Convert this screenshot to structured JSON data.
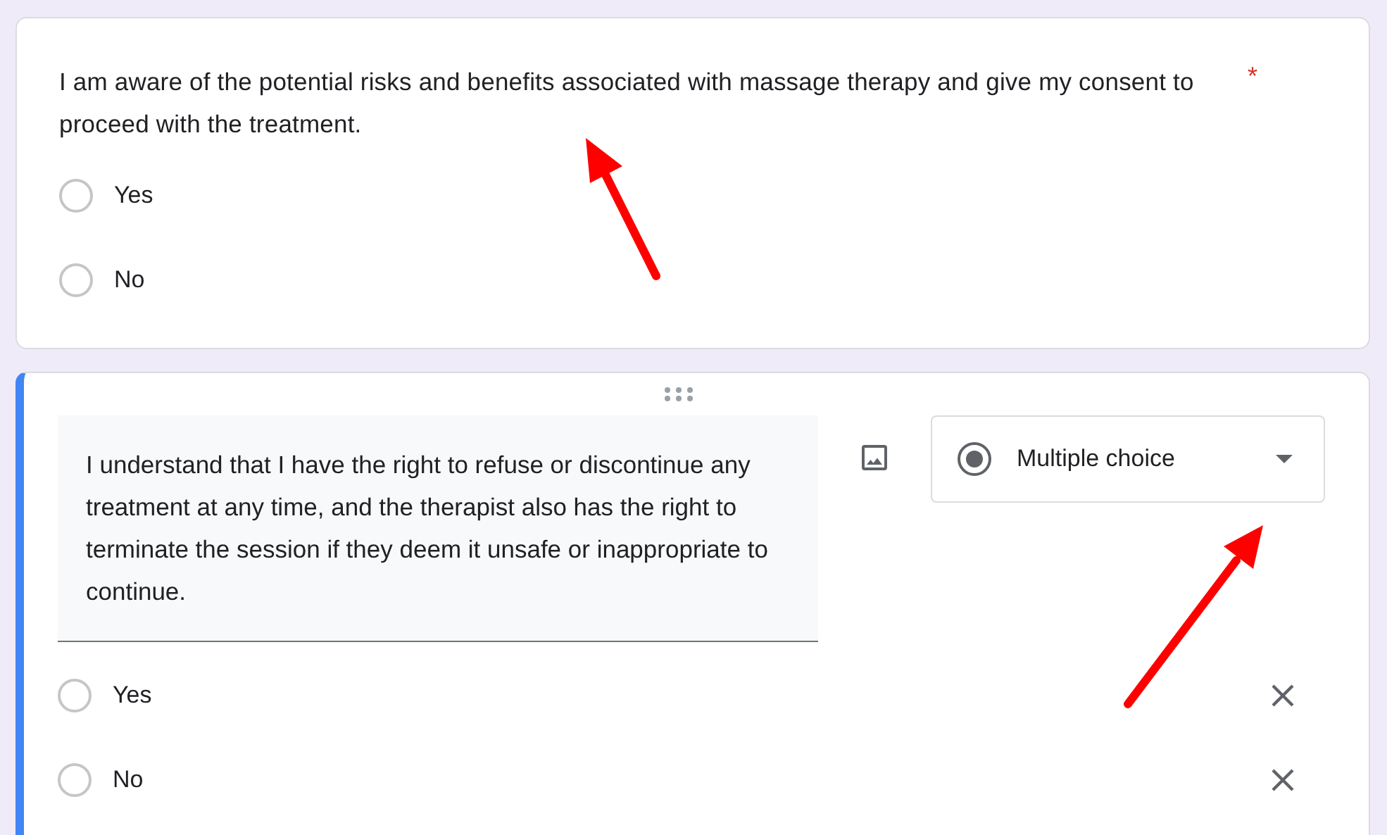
{
  "questions": [
    {
      "kind": "view",
      "text": "I am aware of the potential risks and benefits associated with massage therapy and give my consent to proceed with the treatment.",
      "required_mark": "*",
      "options": [
        {
          "label": "Yes",
          "selected": false
        },
        {
          "label": "No",
          "selected": false
        }
      ]
    },
    {
      "kind": "edit",
      "text": "I understand that I have the right to refuse or discontinue any treatment at any time, and the therapist also has the right to terminate the session if they deem it unsafe or inappropriate to continue.",
      "type_label": "Multiple choice",
      "options": [
        {
          "label": "Yes",
          "selected": false
        },
        {
          "label": "No",
          "selected": false
        }
      ]
    }
  ]
}
